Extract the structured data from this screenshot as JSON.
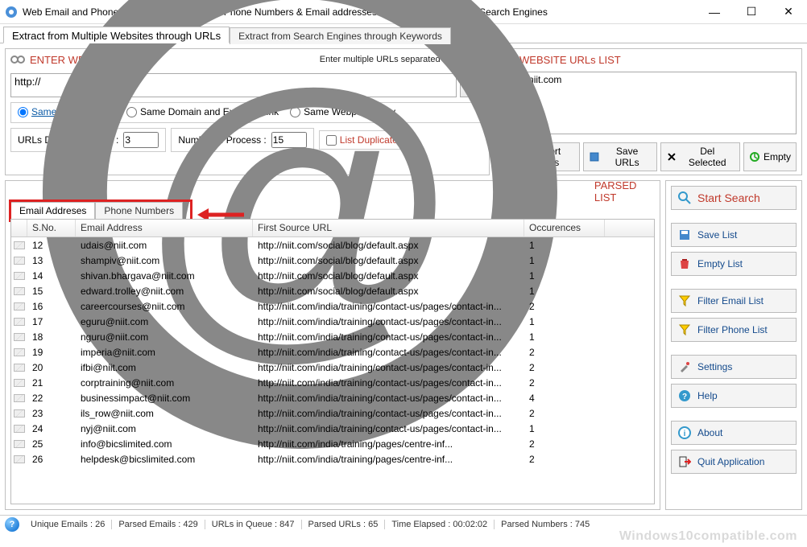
{
  "window": {
    "title": "Web Email and Phone Extractor Pro - Extracts Phone Numbers & Email addresses from Websites/Internet/Search Engines"
  },
  "main_tabs": [
    {
      "label": "Extract from Multiple Websites through URLs",
      "active": true
    },
    {
      "label": "Extract from Search Engines through Keywords",
      "active": false
    }
  ],
  "enter_urls": {
    "title": "ENTER WEBSITE URLs",
    "hint": "Enter multiple URLs separated by Spaces",
    "input_value": "http://",
    "radio_options": [
      "Same Domain Only",
      "Same Domain and External Link",
      "Same Webpage Only"
    ],
    "radio_selected": 0,
    "digg_label": "URLs Digg Upto Level :",
    "digg_value": "3",
    "process_label": "Number of Process :",
    "process_value": "15",
    "list_duplicate_label": "List Duplicate",
    "list_duplicate_checked": false
  },
  "urls_list": {
    "title": "WEBSITE URLs LIST",
    "items": [
      "http://niit.com"
    ],
    "buttons": {
      "import": "Import URLs",
      "save": "Save URLs",
      "del": "Del Selected",
      "empty": "Empty"
    }
  },
  "parsed": {
    "title": "PARSED LIST",
    "sub_tabs": [
      {
        "label": "Email Addreses",
        "active": true
      },
      {
        "label": "Phone Numbers",
        "active": false
      }
    ],
    "columns": [
      "S.No.",
      "Email Address",
      "First Source URL",
      "Occurences"
    ],
    "rows": [
      {
        "sno": "12",
        "email": "udais@niit.com",
        "url": "http://niit.com/social/blog/default.aspx",
        "occ": "1"
      },
      {
        "sno": "13",
        "email": "shampiv@niit.com",
        "url": "http://niit.com/social/blog/default.aspx",
        "occ": "1"
      },
      {
        "sno": "14",
        "email": "shivan.bhargava@niit.com",
        "url": "http://niit.com/social/blog/default.aspx",
        "occ": "1"
      },
      {
        "sno": "15",
        "email": "edward.trolley@niit.com",
        "url": "http://niit.com/social/blog/default.aspx",
        "occ": "1"
      },
      {
        "sno": "16",
        "email": "careercourses@niit.com",
        "url": "http://niit.com/india/training/contact-us/pages/contact-in...",
        "occ": "2"
      },
      {
        "sno": "17",
        "email": "eguru@niit.com",
        "url": "http://niit.com/india/training/contact-us/pages/contact-in...",
        "occ": "1"
      },
      {
        "sno": "18",
        "email": "nguru@niit.com",
        "url": "http://niit.com/india/training/contact-us/pages/contact-in...",
        "occ": "1"
      },
      {
        "sno": "19",
        "email": "imperia@niit.com",
        "url": "http://niit.com/india/training/contact-us/pages/contact-in...",
        "occ": "2"
      },
      {
        "sno": "20",
        "email": "ifbi@niit.com",
        "url": "http://niit.com/india/training/contact-us/pages/contact-in...",
        "occ": "2"
      },
      {
        "sno": "21",
        "email": "corptraining@niit.com",
        "url": "http://niit.com/india/training/contact-us/pages/contact-in...",
        "occ": "2"
      },
      {
        "sno": "22",
        "email": "businessimpact@niit.com",
        "url": "http://niit.com/india/training/contact-us/pages/contact-in...",
        "occ": "4"
      },
      {
        "sno": "23",
        "email": "ils_row@niit.com",
        "url": "http://niit.com/india/training/contact-us/pages/contact-in...",
        "occ": "2"
      },
      {
        "sno": "24",
        "email": "nyj@niit.com",
        "url": "http://niit.com/india/training/contact-us/pages/contact-in...",
        "occ": "1"
      },
      {
        "sno": "25",
        "email": "info@bicslimited.com",
        "url": "http://niit.com/india/training/pages/centre-inf...",
        "occ": "2"
      },
      {
        "sno": "26",
        "email": "helpdesk@bicslimited.com",
        "url": "http://niit.com/india/training/pages/centre-inf...",
        "occ": "2"
      }
    ]
  },
  "sidebar": {
    "search": "Start Search",
    "save_list": "Save List",
    "empty_list": "Empty List",
    "filter_email": "Filter Email List",
    "filter_phone": "Filter Phone List",
    "settings": "Settings",
    "help": "Help",
    "about": "About",
    "quit": "Quit Application"
  },
  "status": {
    "unique_emails": "Unique Emails :  26",
    "parsed_emails": "Parsed Emails :  429",
    "urls_queue": "URLs in Queue :  847",
    "parsed_urls": "Parsed URLs :  65",
    "time_elapsed": "Time Elapsed :   00:02:02",
    "parsed_numbers": "Parsed Numbers :  745"
  },
  "watermark": "Windows10compatible.com"
}
